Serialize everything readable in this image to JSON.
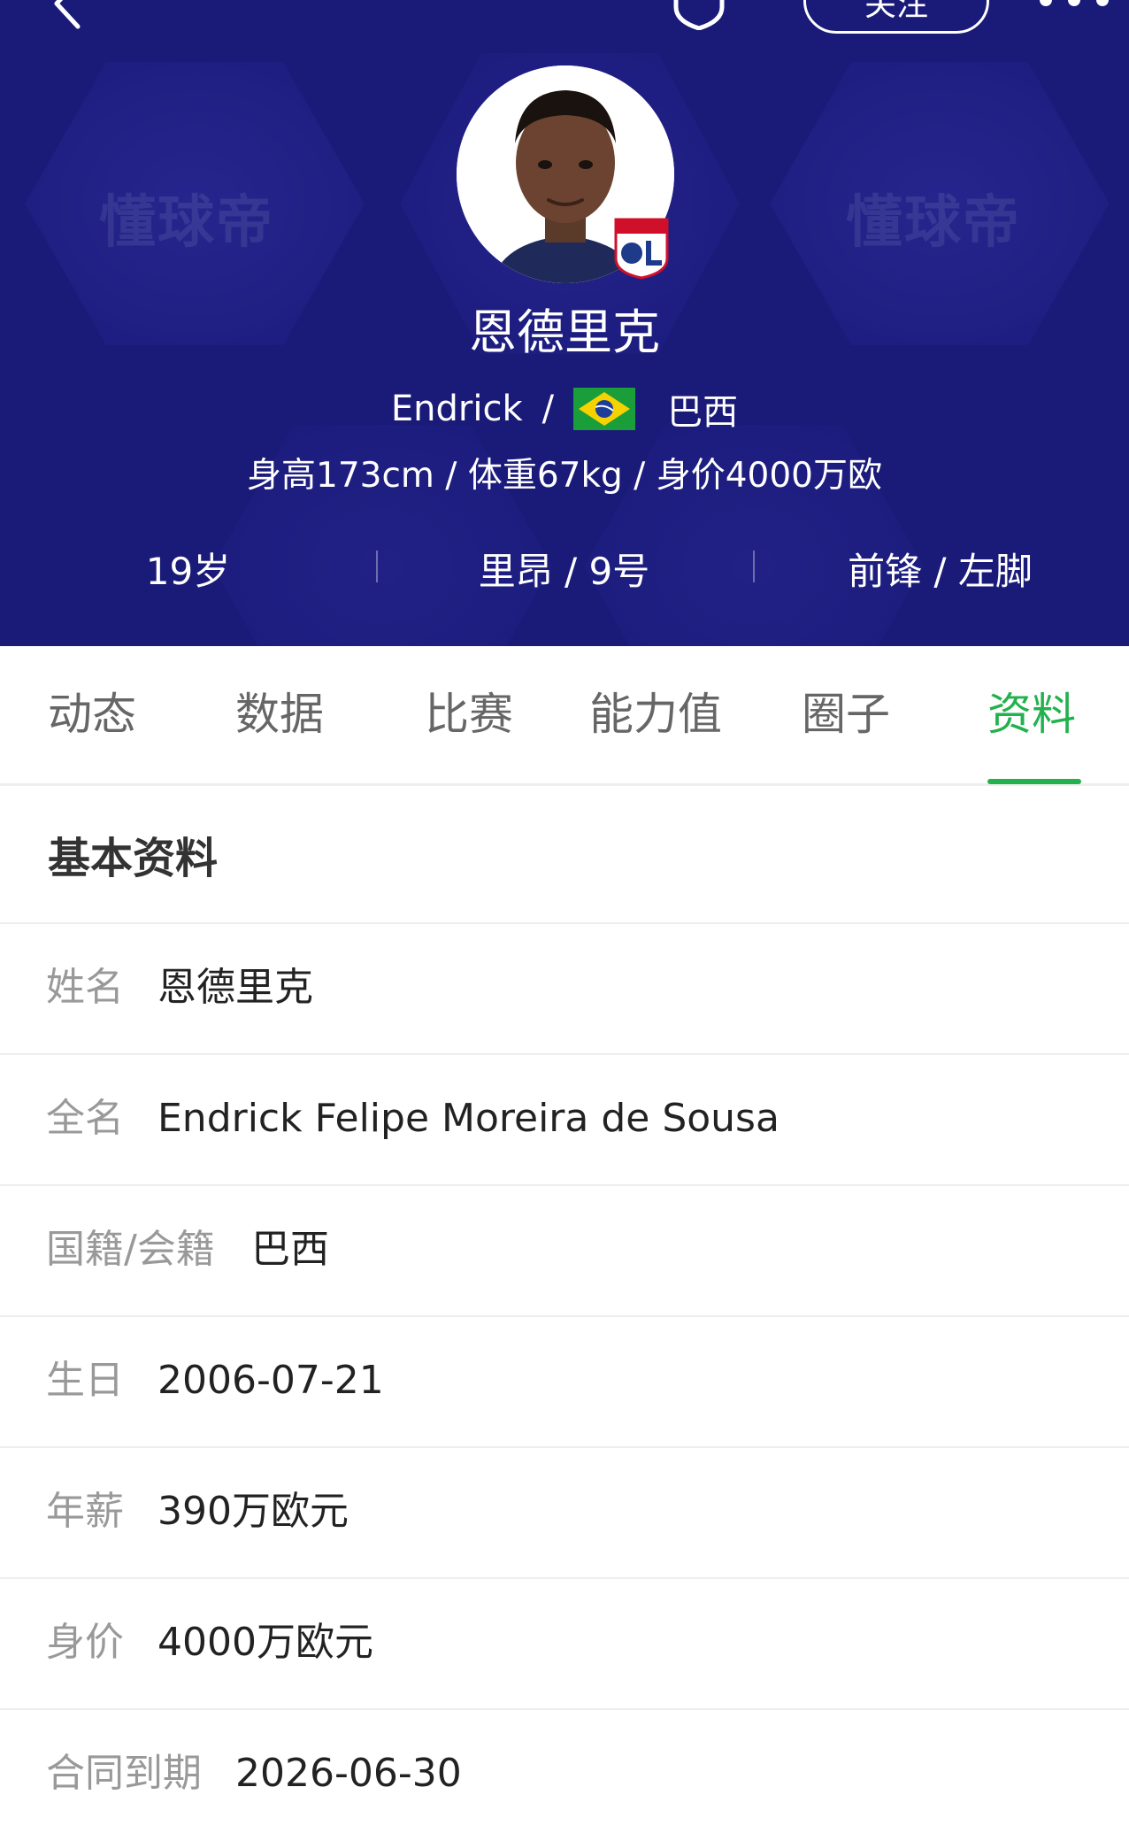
{
  "header": {
    "follow_label": "关注",
    "watermark": "懂球帝",
    "player_name": "恩德里克",
    "english_name": "Endrick",
    "separator": "/",
    "nationality": "巴西",
    "physical": "身高173cm / 体重67kg / 身价4000万欧",
    "age": "19岁",
    "club_number": "里昂 / 9号",
    "position_foot": "前锋 / 左脚",
    "colors": {
      "background": "#1a1a78",
      "text": "#ffffff"
    },
    "icons": [
      "back-arrow-icon",
      "shield-icon",
      "more-dots-icon",
      "brazil-flag-icon",
      "lyon-club-badge"
    ]
  },
  "tabs": {
    "items": [
      "动态",
      "数据",
      "比赛",
      "能力值",
      "圈子",
      "资料"
    ],
    "active_index": 5,
    "active_color": "#22b14c"
  },
  "profile": {
    "section_title": "基本资料",
    "rows": [
      {
        "label": "姓名",
        "value": "恩德里克"
      },
      {
        "label": "全名",
        "value": "Endrick Felipe Moreira de Sousa"
      },
      {
        "label": "国籍/会籍",
        "value": "巴西"
      },
      {
        "label": "生日",
        "value": "2006-07-21"
      },
      {
        "label": "年薪",
        "value": "390万欧元"
      },
      {
        "label": "身价",
        "value": "4000万欧元"
      },
      {
        "label": "合同到期",
        "value": "2026-06-30"
      }
    ]
  }
}
